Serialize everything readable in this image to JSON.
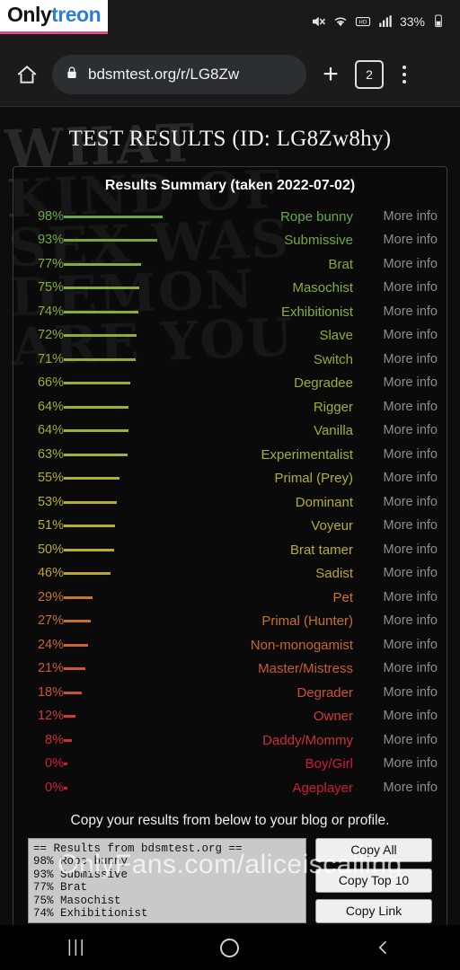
{
  "watermark": {
    "top_a": "Only",
    "top_b": "treon",
    "bottom": "OnlyFans.com/aliceiscalling"
  },
  "status_bar": {
    "battery_percent": "33%",
    "icons": [
      "mute-icon",
      "wifi-icon",
      "hd-voice-icon",
      "signal-icon",
      "battery-icon"
    ]
  },
  "toolbar": {
    "home_icon": "home-icon",
    "lock_icon": "lock-icon",
    "url": "bdsmtest.org/r/LG8Zw",
    "new_tab_label": "+",
    "tab_count": "2",
    "menu_icon": "overflow-menu-icon"
  },
  "page": {
    "title_prefix": "T",
    "title": "TEST RESULTS (ID: LG8Zw8hy)",
    "background_text": "WHAT\nKIND OF\nSEX WAS\nDEMON\nARE YOU",
    "summary_title": "Results Summary (taken 2022-07-02)",
    "more_info_label": "More info",
    "copy_instruction": "Copy your results from below to your blog or profile.",
    "textarea_value": "== Results from bdsmtest.org ==\n98% Rope bunny\n93% Submissive\n77% Brat\n75% Masochist\n74% Exhibitionist",
    "buttons": {
      "copy_all": "Copy All",
      "copy_top_10": "Copy Top 10",
      "copy_link": "Copy Link"
    }
  },
  "results": [
    {
      "percent": "98%",
      "label": "Rope bunny",
      "value": 98,
      "color": "#6aa84f"
    },
    {
      "percent": "93%",
      "label": "Submissive",
      "value": 93,
      "color": "#73a83f"
    },
    {
      "percent": "77%",
      "label": "Brat",
      "value": 77,
      "color": "#83ad3a"
    },
    {
      "percent": "75%",
      "label": "Masochist",
      "value": 75,
      "color": "#86ae39"
    },
    {
      "percent": "74%",
      "label": "Exhibitionist",
      "value": 74,
      "color": "#88ae38"
    },
    {
      "percent": "72%",
      "label": "Slave",
      "value": 72,
      "color": "#8bae37"
    },
    {
      "percent": "71%",
      "label": "Switch",
      "value": 71,
      "color": "#8dae37"
    },
    {
      "percent": "66%",
      "label": "Degradee",
      "value": 66,
      "color": "#97b035"
    },
    {
      "percent": "64%",
      "label": "Rigger",
      "value": 64,
      "color": "#9bb134"
    },
    {
      "percent": "64%",
      "label": "Vanilla",
      "value": 64,
      "color": "#9bb134"
    },
    {
      "percent": "63%",
      "label": "Experimentalist",
      "value": 63,
      "color": "#9db134"
    },
    {
      "percent": "55%",
      "label": "Primal (Prey)",
      "value": 55,
      "color": "#aeb030"
    },
    {
      "percent": "53%",
      "label": "Dominant",
      "value": 53,
      "color": "#b2af2f"
    },
    {
      "percent": "51%",
      "label": "Voyeur",
      "value": 51,
      "color": "#b6ae2e"
    },
    {
      "percent": "50%",
      "label": "Brat tamer",
      "value": 50,
      "color": "#b8ad2e"
    },
    {
      "percent": "46%",
      "label": "Sadist",
      "value": 46,
      "color": "#bfa22c"
    },
    {
      "percent": "29%",
      "label": "Pet",
      "value": 29,
      "color": "#c8762e"
    },
    {
      "percent": "27%",
      "label": "Primal (Hunter)",
      "value": 27,
      "color": "#c96f2f"
    },
    {
      "percent": "24%",
      "label": "Non-monogamist",
      "value": 24,
      "color": "#ca6530"
    },
    {
      "percent": "21%",
      "label": "Master/Mistress",
      "value": 21,
      "color": "#cb5a31"
    },
    {
      "percent": "18%",
      "label": "Degrader",
      "value": 18,
      "color": "#cc5033"
    },
    {
      "percent": "12%",
      "label": "Owner",
      "value": 12,
      "color": "#cd3b36"
    },
    {
      "percent": "8%",
      "label": "Daddy/Mommy",
      "value": 8,
      "color": "#ce2e38"
    },
    {
      "percent": "0%",
      "label": "Boy/Girl",
      "value": 0,
      "color": "#d01a3b"
    },
    {
      "percent": "0%",
      "label": "Ageplayer",
      "value": 0,
      "color": "#d01a3b"
    }
  ],
  "navbar": {
    "recents": "|||",
    "home": "home-circle-icon",
    "back": "back-chevron-icon"
  }
}
